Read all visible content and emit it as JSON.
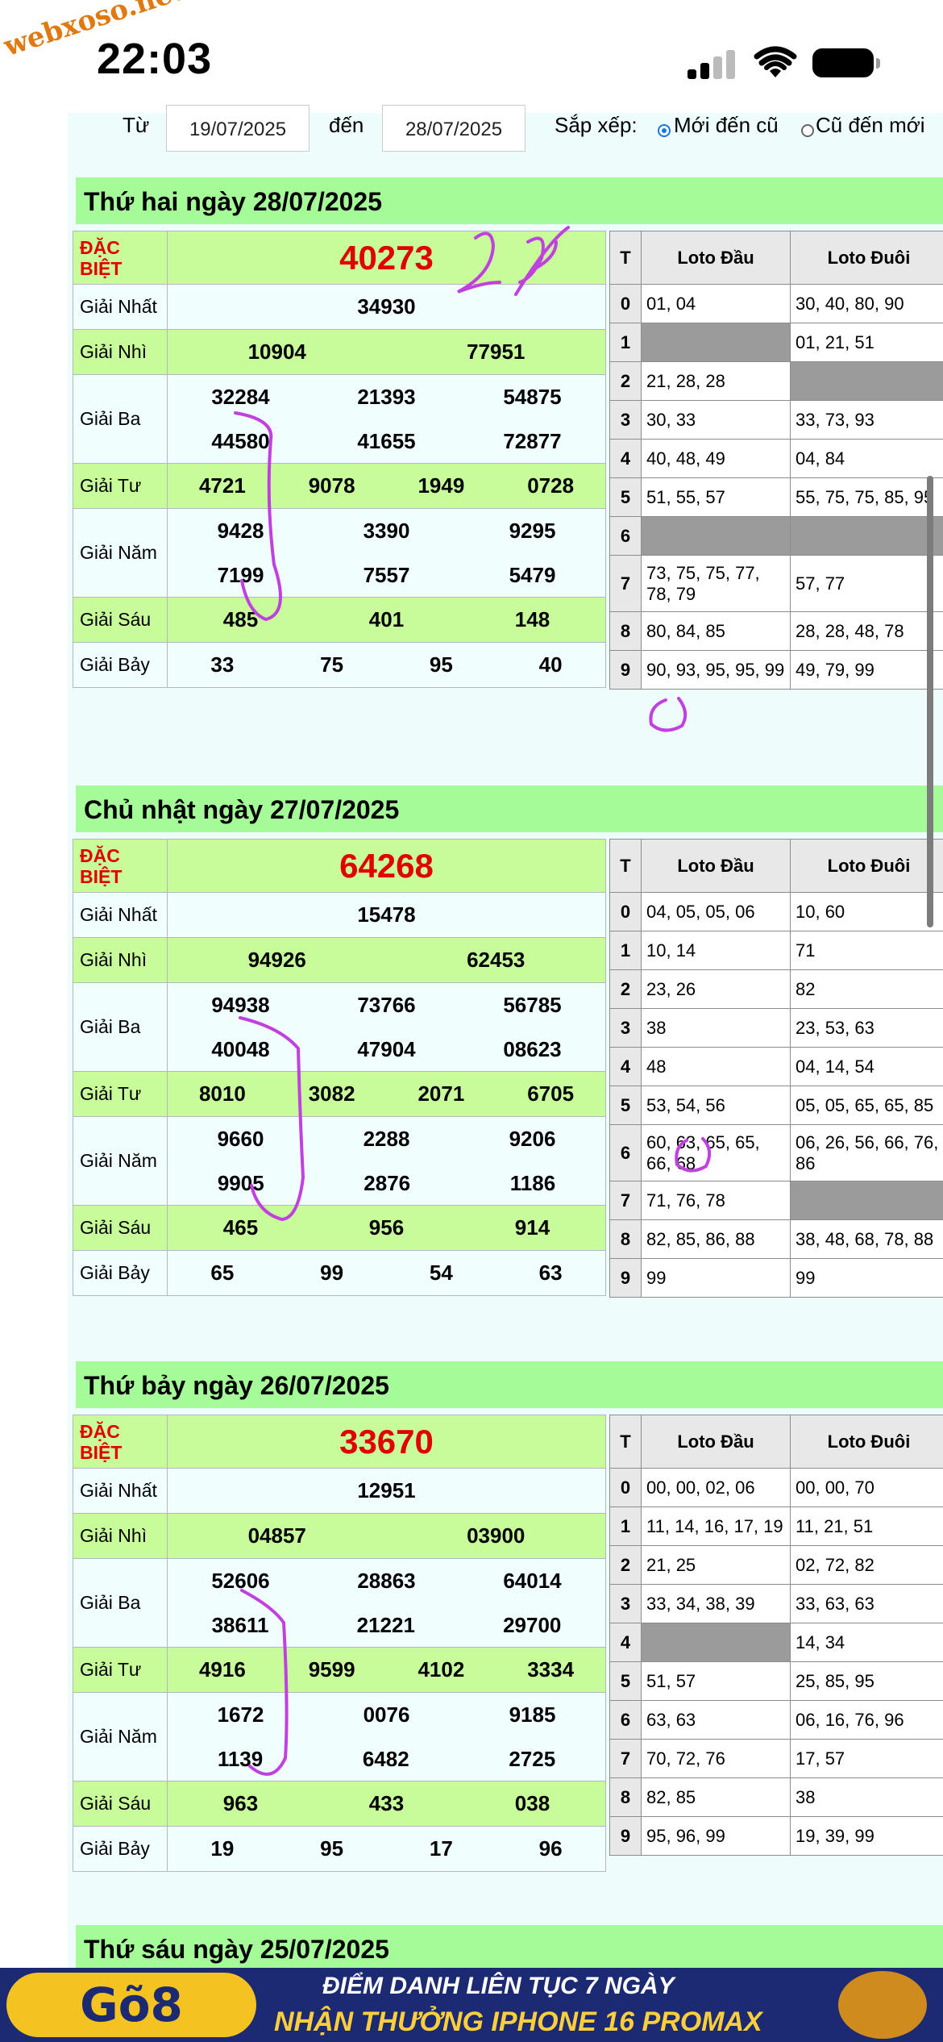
{
  "status": {
    "time": "22:03",
    "watermark": "webxoso.net"
  },
  "filter": {
    "from_label": "Từ",
    "from_value": "19/07/2025",
    "to_label": "đến",
    "to_value": "28/07/2025",
    "sort_label": "Sắp xếp:",
    "opt_new": "Mới đến cũ",
    "opt_old": "Cũ đến mới"
  },
  "labels": {
    "special": "ĐẶC BIỆT",
    "g1": "Giải Nhất",
    "g2": "Giải Nhì",
    "g3": "Giải Ba",
    "g4": "Giải Tư",
    "g5": "Giải Năm",
    "g6": "Giải Sáu",
    "g7": "Giải Bảy",
    "t": "T",
    "dau": "Loto Đầu",
    "duoi": "Loto Đuôi"
  },
  "days": [
    {
      "title": "Thứ hai ngày 28/07/2025",
      "special": "40273",
      "g1": "34930",
      "g2": [
        "10904",
        "77951"
      ],
      "g3": [
        "32284",
        "21393",
        "54875",
        "44580",
        "41655",
        "72877"
      ],
      "g4": [
        "4721",
        "9078",
        "1949",
        "0728"
      ],
      "g5": [
        "9428",
        "3390",
        "9295",
        "7199",
        "7557",
        "5479"
      ],
      "g6": [
        "485",
        "401",
        "148"
      ],
      "g7": [
        "33",
        "75",
        "95",
        "40"
      ],
      "loto": [
        [
          "0",
          "01, 04",
          "30, 40, 80, 90"
        ],
        [
          "1",
          "",
          "01, 21, 51"
        ],
        [
          "2",
          "21, 28, 28",
          ""
        ],
        [
          "3",
          "30, 33",
          "33, 73, 93"
        ],
        [
          "4",
          "40, 48, 49",
          "04, 84"
        ],
        [
          "5",
          "51, 55, 57",
          "55, 75, 75, 85, 95"
        ],
        [
          "6",
          "",
          ""
        ],
        [
          "7",
          "73, 75, 75, 77, 78, 79",
          "57, 77"
        ],
        [
          "8",
          "80, 84, 85",
          "28, 28, 48, 78"
        ],
        [
          "9",
          "90, 93, 95, 95, 99",
          "49, 79, 99"
        ]
      ]
    },
    {
      "title": "Chủ nhật ngày 27/07/2025",
      "special": "64268",
      "g1": "15478",
      "g2": [
        "94926",
        "62453"
      ],
      "g3": [
        "94938",
        "73766",
        "56785",
        "40048",
        "47904",
        "08623"
      ],
      "g4": [
        "8010",
        "3082",
        "2071",
        "6705"
      ],
      "g5": [
        "9660",
        "2288",
        "9206",
        "9905",
        "2876",
        "1186"
      ],
      "g6": [
        "465",
        "956",
        "914"
      ],
      "g7": [
        "65",
        "99",
        "54",
        "63"
      ],
      "loto": [
        [
          "0",
          "04, 05, 05, 06",
          "10, 60"
        ],
        [
          "1",
          "10, 14",
          "71"
        ],
        [
          "2",
          "23, 26",
          "82"
        ],
        [
          "3",
          "38",
          "23, 53, 63"
        ],
        [
          "4",
          "48",
          "04, 14, 54"
        ],
        [
          "5",
          "53, 54, 56",
          "05, 05, 65, 65, 85"
        ],
        [
          "6",
          "60, 63, 65, 65, 66, 68",
          "06, 26, 56, 66, 76, 86"
        ],
        [
          "7",
          "71, 76, 78",
          ""
        ],
        [
          "8",
          "82, 85, 86, 88",
          "38, 48, 68, 78, 88"
        ],
        [
          "9",
          "99",
          "99"
        ]
      ]
    },
    {
      "title": "Thứ bảy ngày 26/07/2025",
      "special": "33670",
      "g1": "12951",
      "g2": [
        "04857",
        "03900"
      ],
      "g3": [
        "52606",
        "28863",
        "64014",
        "38611",
        "21221",
        "29700"
      ],
      "g4": [
        "4916",
        "9599",
        "4102",
        "3334"
      ],
      "g5": [
        "1672",
        "0076",
        "9185",
        "1139",
        "6482",
        "2725"
      ],
      "g6": [
        "963",
        "433",
        "038"
      ],
      "g7": [
        "19",
        "95",
        "17",
        "96"
      ],
      "loto": [
        [
          "0",
          "00, 00, 02, 06",
          "00, 00, 70"
        ],
        [
          "1",
          "11, 14, 16, 17, 19",
          "11, 21, 51"
        ],
        [
          "2",
          "21, 25",
          "02, 72, 82"
        ],
        [
          "3",
          "33, 34, 38, 39",
          "33, 63, 63"
        ],
        [
          "4",
          "",
          "14, 34"
        ],
        [
          "5",
          "51, 57",
          "25, 85, 95"
        ],
        [
          "6",
          "63, 63",
          "06, 16, 76, 96"
        ],
        [
          "7",
          "70, 72, 76",
          "17, 57"
        ],
        [
          "8",
          "82, 85",
          "38"
        ],
        [
          "9",
          "95, 96, 99",
          "19, 39, 99"
        ]
      ]
    }
  ],
  "next_day_title": "Thứ sáu ngày 25/07/2025",
  "banner": {
    "logo": "Gõ8",
    "line1": "ĐIỂM DANH LIÊN TỤC 7 NGÀY",
    "line2": "NHẬN THƯỞNG IPHONE 16 PROMAX"
  },
  "handwriting": "292"
}
